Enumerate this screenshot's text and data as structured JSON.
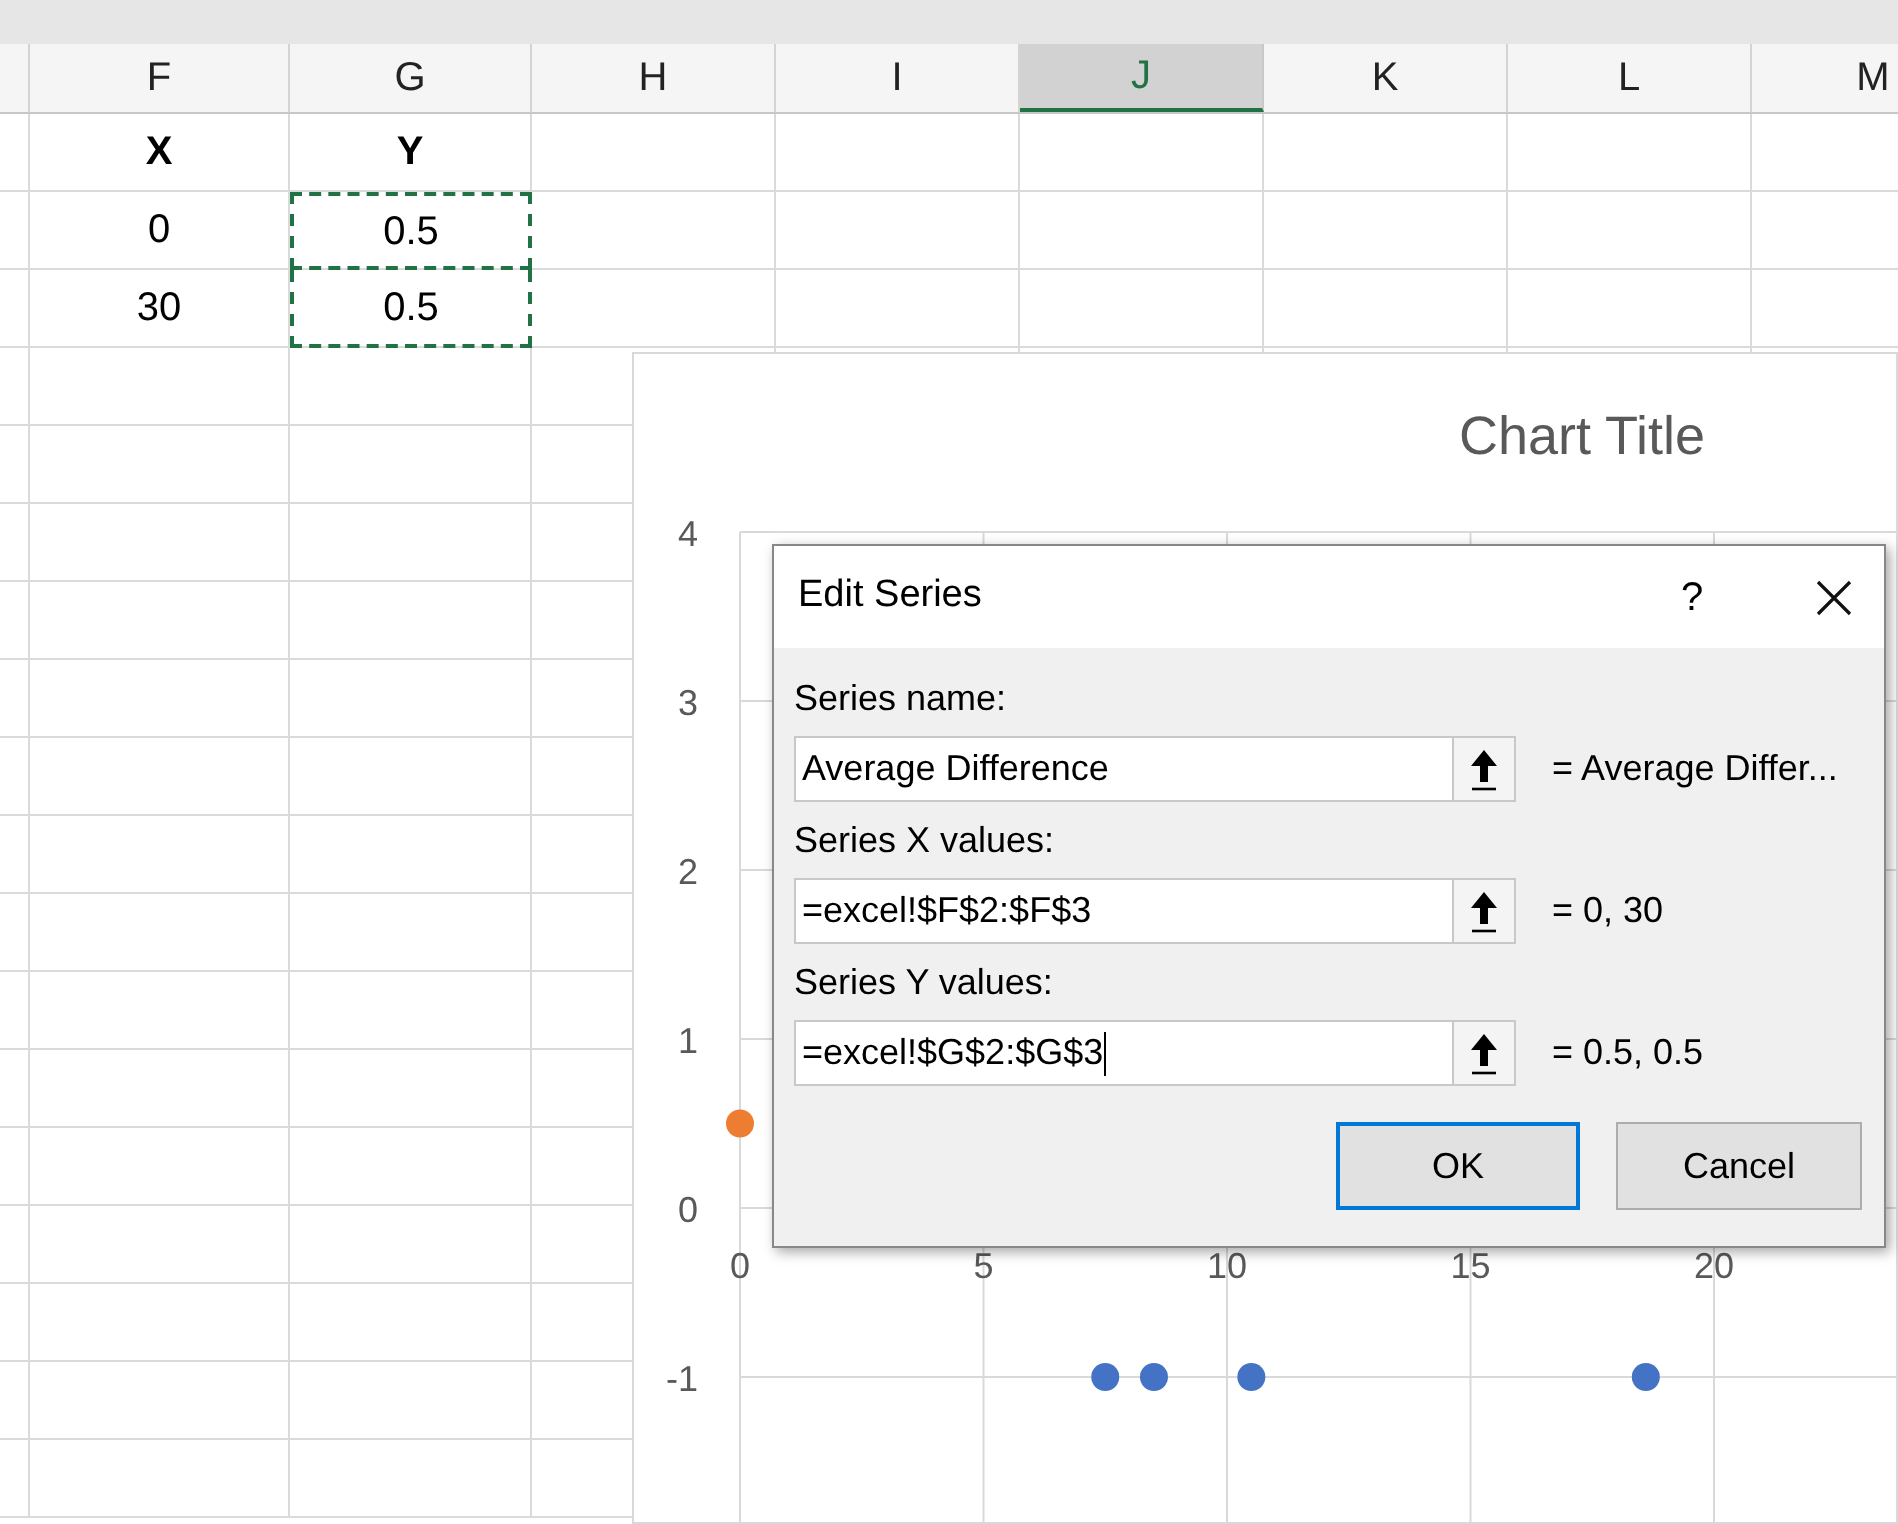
{
  "sheet": {
    "columns": [
      {
        "label": "F",
        "selected": false
      },
      {
        "label": "G",
        "selected": false
      },
      {
        "label": "H",
        "selected": false
      },
      {
        "label": "I",
        "selected": false
      },
      {
        "label": "J",
        "selected": true
      },
      {
        "label": "K",
        "selected": false
      },
      {
        "label": "L",
        "selected": false
      },
      {
        "label": "M",
        "selected": false
      }
    ],
    "rows": [
      {
        "cells": [
          {
            "text": "X",
            "bold": true,
            "marquee": false
          },
          {
            "text": "Y",
            "bold": true,
            "marquee": false
          }
        ]
      },
      {
        "cells": [
          {
            "text": "0",
            "bold": false,
            "marquee": false
          },
          {
            "text": "0.5",
            "bold": false,
            "marquee": true
          }
        ]
      },
      {
        "cells": [
          {
            "text": "30",
            "bold": false,
            "marquee": false
          },
          {
            "text": "0.5",
            "bold": false,
            "marquee": true
          }
        ]
      }
    ]
  },
  "chart": {
    "chart_data": {
      "type": "scatter",
      "title": "Chart Title",
      "xlim": [
        0,
        25
      ],
      "ylim": [
        -2,
        4
      ],
      "grid": true,
      "xticks": [
        0,
        5,
        10,
        15,
        20
      ],
      "yticks": [
        -1,
        0,
        1,
        2,
        3,
        4
      ],
      "series": [
        {
          "color": "#4472c4",
          "x": [
            7.5,
            8.5,
            10.5,
            18.6
          ],
          "values": [
            -1,
            -1,
            -1,
            -1
          ]
        },
        {
          "color": "#ed7d31",
          "x": [
            0
          ],
          "values": [
            0.5
          ]
        }
      ]
    }
  },
  "dialog": {
    "title": "Edit Series",
    "help": "?",
    "fields": [
      {
        "label": "Series name:",
        "value": "Average Difference",
        "result": "= Average Differ...",
        "focused": false
      },
      {
        "label": "Series X values:",
        "value": "=excel!$F$2:$F$3",
        "result": "= 0, 30",
        "focused": false
      },
      {
        "label": "Series Y values:",
        "value": "=excel!$G$2:$G$3",
        "result": "= 0.5, 0.5",
        "focused": true
      }
    ],
    "buttons": [
      {
        "label": "OK",
        "default": true
      },
      {
        "label": "Cancel",
        "default": false
      }
    ]
  }
}
